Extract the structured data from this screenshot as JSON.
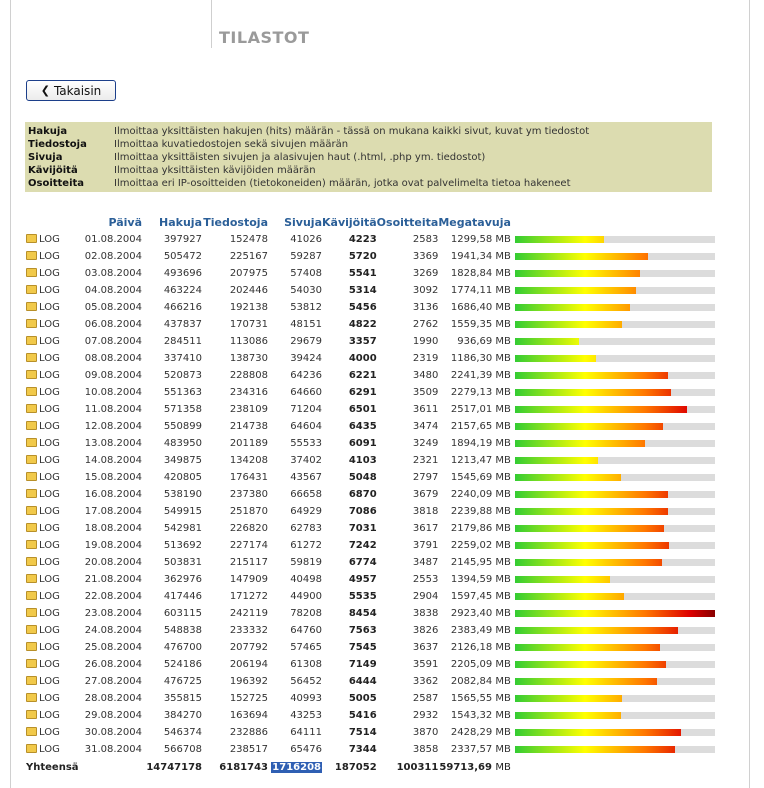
{
  "header": {
    "title": "TILASTOT"
  },
  "back_button": {
    "label": "Takaisin"
  },
  "legend": [
    {
      "term": "Hakuja",
      "desc": "Ilmoittaa yksittäisten hakujen (hits) määrän - tässä on mukana kaikki sivut, kuvat ym tiedostot"
    },
    {
      "term": "Tiedostoja",
      "desc": "Ilmoittaa kuvatiedostojen sekä sivujen määrän"
    },
    {
      "term": "Sivuja",
      "desc": "Ilmoittaa yksittäisten sivujen ja alasivujen haut (.html, .php ym. tiedostot)"
    },
    {
      "term": "Kävijöitä",
      "desc": "Ilmoittaa yksittäisten kävijöiden määrän"
    },
    {
      "term": "Osoitteita",
      "desc": "Ilmoittaa eri IP-osoitteiden (tietokoneiden) määrän, jotka ovat palvelimelta tietoa hakeneet"
    }
  ],
  "columns": {
    "day": "Päivä",
    "hits": "Hakuja",
    "files": "Tiedostoja",
    "pages": "Sivuja",
    "visits": "Kävijöitä",
    "hosts": "Osoitteita",
    "mb": "Megatavuja"
  },
  "log_label": "LOG",
  "mb_unit": "MB",
  "max_mb": 2923.4,
  "rows": [
    {
      "date": "01.08.2004",
      "hits": "397927",
      "files": "152478",
      "pages": "41026",
      "visits": "4223",
      "hosts": "2583",
      "mb": "1299,58",
      "mb_value": 1299.58
    },
    {
      "date": "02.08.2004",
      "hits": "505472",
      "files": "225167",
      "pages": "59287",
      "visits": "5720",
      "hosts": "3369",
      "mb": "1941,34",
      "mb_value": 1941.34
    },
    {
      "date": "03.08.2004",
      "hits": "493696",
      "files": "207975",
      "pages": "57408",
      "visits": "5541",
      "hosts": "3269",
      "mb": "1828,84",
      "mb_value": 1828.84
    },
    {
      "date": "04.08.2004",
      "hits": "463224",
      "files": "202446",
      "pages": "54030",
      "visits": "5314",
      "hosts": "3092",
      "mb": "1774,11",
      "mb_value": 1774.11
    },
    {
      "date": "05.08.2004",
      "hits": "466216",
      "files": "192138",
      "pages": "53812",
      "visits": "5456",
      "hosts": "3136",
      "mb": "1686,40",
      "mb_value": 1686.4
    },
    {
      "date": "06.08.2004",
      "hits": "437837",
      "files": "170731",
      "pages": "48151",
      "visits": "4822",
      "hosts": "2762",
      "mb": "1559,35",
      "mb_value": 1559.35
    },
    {
      "date": "07.08.2004",
      "hits": "284511",
      "files": "113086",
      "pages": "29679",
      "visits": "3357",
      "hosts": "1990",
      "mb": "936,69",
      "mb_value": 936.69
    },
    {
      "date": "08.08.2004",
      "hits": "337410",
      "files": "138730",
      "pages": "39424",
      "visits": "4000",
      "hosts": "2319",
      "mb": "1186,30",
      "mb_value": 1186.3
    },
    {
      "date": "09.08.2004",
      "hits": "520873",
      "files": "228808",
      "pages": "64236",
      "visits": "6221",
      "hosts": "3480",
      "mb": "2241,39",
      "mb_value": 2241.39
    },
    {
      "date": "10.08.2004",
      "hits": "551363",
      "files": "234316",
      "pages": "64660",
      "visits": "6291",
      "hosts": "3509",
      "mb": "2279,13",
      "mb_value": 2279.13
    },
    {
      "date": "11.08.2004",
      "hits": "571358",
      "files": "238109",
      "pages": "71204",
      "visits": "6501",
      "hosts": "3611",
      "mb": "2517,01",
      "mb_value": 2517.01
    },
    {
      "date": "12.08.2004",
      "hits": "550899",
      "files": "214738",
      "pages": "64604",
      "visits": "6435",
      "hosts": "3474",
      "mb": "2157,65",
      "mb_value": 2157.65
    },
    {
      "date": "13.08.2004",
      "hits": "483950",
      "files": "201189",
      "pages": "55533",
      "visits": "6091",
      "hosts": "3249",
      "mb": "1894,19",
      "mb_value": 1894.19
    },
    {
      "date": "14.08.2004",
      "hits": "349875",
      "files": "134208",
      "pages": "37402",
      "visits": "4103",
      "hosts": "2321",
      "mb": "1213,47",
      "mb_value": 1213.47
    },
    {
      "date": "15.08.2004",
      "hits": "420805",
      "files": "176431",
      "pages": "43567",
      "visits": "5048",
      "hosts": "2797",
      "mb": "1545,69",
      "mb_value": 1545.69
    },
    {
      "date": "16.08.2004",
      "hits": "538190",
      "files": "237380",
      "pages": "66658",
      "visits": "6870",
      "hosts": "3679",
      "mb": "2240,09",
      "mb_value": 2240.09
    },
    {
      "date": "17.08.2004",
      "hits": "549915",
      "files": "251870",
      "pages": "64929",
      "visits": "7086",
      "hosts": "3818",
      "mb": "2239,88",
      "mb_value": 2239.88
    },
    {
      "date": "18.08.2004",
      "hits": "542981",
      "files": "226820",
      "pages": "62783",
      "visits": "7031",
      "hosts": "3617",
      "mb": "2179,86",
      "mb_value": 2179.86
    },
    {
      "date": "19.08.2004",
      "hits": "513692",
      "files": "227174",
      "pages": "61272",
      "visits": "7242",
      "hosts": "3791",
      "mb": "2259,02",
      "mb_value": 2259.02
    },
    {
      "date": "20.08.2004",
      "hits": "503831",
      "files": "215117",
      "pages": "59819",
      "visits": "6774",
      "hosts": "3487",
      "mb": "2145,95",
      "mb_value": 2145.95
    },
    {
      "date": "21.08.2004",
      "hits": "362976",
      "files": "147909",
      "pages": "40498",
      "visits": "4957",
      "hosts": "2553",
      "mb": "1394,59",
      "mb_value": 1394.59
    },
    {
      "date": "22.08.2004",
      "hits": "417446",
      "files": "171272",
      "pages": "44900",
      "visits": "5535",
      "hosts": "2904",
      "mb": "1597,45",
      "mb_value": 1597.45
    },
    {
      "date": "23.08.2004",
      "hits": "603115",
      "files": "242119",
      "pages": "78208",
      "visits": "8454",
      "hosts": "3838",
      "mb": "2923,40",
      "mb_value": 2923.4
    },
    {
      "date": "24.08.2004",
      "hits": "548838",
      "files": "233332",
      "pages": "64760",
      "visits": "7563",
      "hosts": "3826",
      "mb": "2383,49",
      "mb_value": 2383.49
    },
    {
      "date": "25.08.2004",
      "hits": "476700",
      "files": "207792",
      "pages": "57465",
      "visits": "7545",
      "hosts": "3637",
      "mb": "2126,18",
      "mb_value": 2126.18
    },
    {
      "date": "26.08.2004",
      "hits": "524186",
      "files": "206194",
      "pages": "61308",
      "visits": "7149",
      "hosts": "3591",
      "mb": "2205,09",
      "mb_value": 2205.09
    },
    {
      "date": "27.08.2004",
      "hits": "476725",
      "files": "196392",
      "pages": "56452",
      "visits": "6444",
      "hosts": "3362",
      "mb": "2082,84",
      "mb_value": 2082.84
    },
    {
      "date": "28.08.2004",
      "hits": "355815",
      "files": "152725",
      "pages": "40993",
      "visits": "5005",
      "hosts": "2587",
      "mb": "1565,55",
      "mb_value": 1565.55
    },
    {
      "date": "29.08.2004",
      "hits": "384270",
      "files": "163694",
      "pages": "43253",
      "visits": "5416",
      "hosts": "2932",
      "mb": "1543,32",
      "mb_value": 1543.32
    },
    {
      "date": "30.08.2004",
      "hits": "546374",
      "files": "232886",
      "pages": "64111",
      "visits": "7514",
      "hosts": "3870",
      "mb": "2428,29",
      "mb_value": 2428.29
    },
    {
      "date": "31.08.2004",
      "hits": "566708",
      "files": "238517",
      "pages": "65476",
      "visits": "7344",
      "hosts": "3858",
      "mb": "2337,57",
      "mb_value": 2337.57
    }
  ],
  "totals": {
    "label": "Yhteensä",
    "hits": "14747178",
    "files": "6181743",
    "pages": "1716208",
    "visits": "187052",
    "hosts": "100311",
    "mb": "59713,69"
  }
}
